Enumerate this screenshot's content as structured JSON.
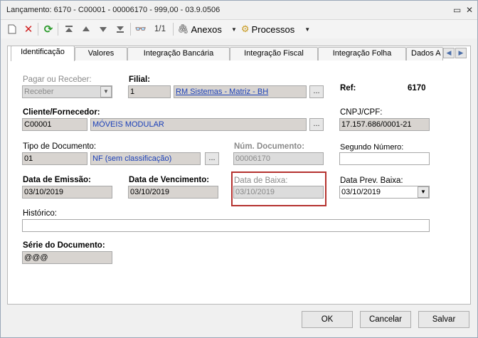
{
  "window": {
    "title": "Lançamento: 6170 - C00001 - 00006170 - 999,00 - 03.9.0506"
  },
  "toolbar": {
    "nav_count": "1/1",
    "anexos_label": "Anexos",
    "processos_label": "Processos"
  },
  "tabs": [
    {
      "label": "Identificação"
    },
    {
      "label": "Valores"
    },
    {
      "label": "Integração Bancária"
    },
    {
      "label": "Integração Fiscal"
    },
    {
      "label": "Integração Folha"
    },
    {
      "label": "Dados A"
    }
  ],
  "form": {
    "pagar_label": "Pagar ou Receber:",
    "pagar_value": "Receber",
    "filial_label": "Filial:",
    "filial_code": "1",
    "filial_name": "RM Sistemas - Matriz - BH",
    "ref_label": "Ref:",
    "ref_value": "6170",
    "cliente_label": "Cliente/Fornecedor:",
    "cliente_code": "C00001",
    "cliente_name": "MÓVEIS MODULAR",
    "cnpj_label": "CNPJ/CPF:",
    "cnpj_value": "17.157.686/0001-21",
    "tipo_label": "Tipo de Documento:",
    "tipo_code": "01",
    "tipo_name": "NF (sem classificação)",
    "num_doc_label": "Núm. Documento:",
    "num_doc_value": "00006170",
    "segundo_label": "Segundo Número:",
    "segundo_value": "",
    "emissao_label": "Data de Emissão:",
    "emissao_value": "03/10/2019",
    "vencimento_label": "Data de Vencimento:",
    "vencimento_value": "03/10/2019",
    "baixa_label": "Data de Baixa:",
    "baixa_value": "03/10/2019",
    "prev_baixa_label": "Data Prev. Baixa:",
    "prev_baixa_value": "03/10/2019",
    "historico_label": "Histórico:",
    "historico_value": "",
    "serie_label": "Série do Documento:",
    "serie_value": "@@@",
    "ellipsis": "..."
  },
  "buttons": {
    "ok": "OK",
    "cancelar": "Cancelar",
    "salvar": "Salvar"
  },
  "colors": {
    "highlight_box": "#b5322f",
    "link": "#1a3fb8"
  }
}
